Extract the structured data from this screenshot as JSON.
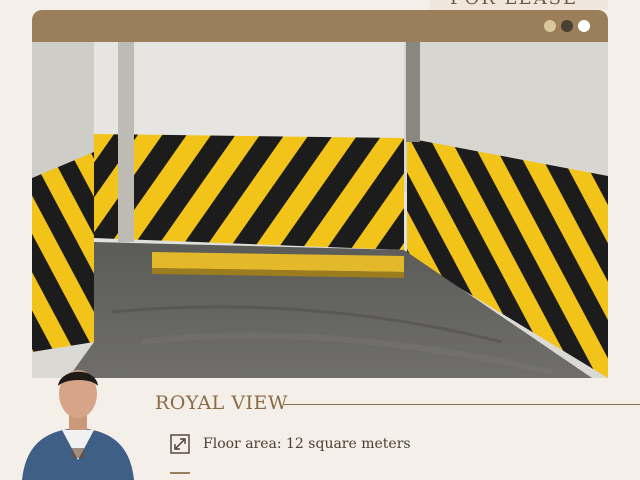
{
  "header": {
    "tag_label": "FOR LEASE",
    "dot_colors": [
      "#d8c89a",
      "#4a3f33",
      "#ffffff"
    ]
  },
  "photo": {
    "subject": "parking slot with yellow and black hazard stripes"
  },
  "listing": {
    "title": "ROYAL VIEW",
    "floor_area": "Floor area: 12 square meters"
  },
  "colors": {
    "accent": "#9a7f5a",
    "title": "#8a6b46",
    "background": "#f4efe8",
    "stripe_yellow": "#f2c318",
    "stripe_black": "#1c1c1c"
  },
  "icons": {
    "floor_area": "expand-diagonal-icon"
  }
}
